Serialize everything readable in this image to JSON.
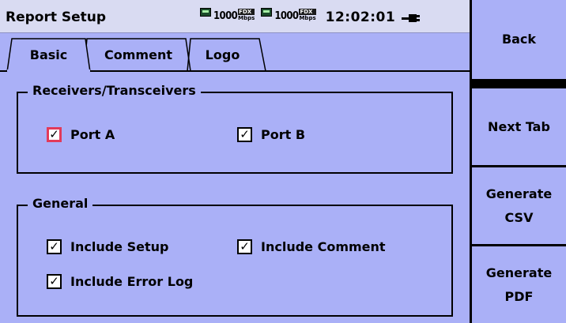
{
  "window": {
    "title": "Report Setup"
  },
  "status_bar": {
    "links": [
      {
        "speed": "1000",
        "duplex": "FDX",
        "unit": "Mbps"
      },
      {
        "speed": "1000",
        "duplex": "FDX",
        "unit": "Mbps"
      }
    ],
    "clock": "12:02:01",
    "link_color": "#13b13b"
  },
  "tabs": [
    {
      "label": "Basic",
      "active": true
    },
    {
      "label": "Comment",
      "active": false
    },
    {
      "label": "Logo",
      "active": false
    }
  ],
  "receivers": {
    "title": "Receivers/Transceivers",
    "port_a": {
      "label": "Port A",
      "checked": true,
      "focused": true
    },
    "port_b": {
      "label": "Port B",
      "checked": true
    }
  },
  "general": {
    "title": "General",
    "include_setup": {
      "label": "Include Setup",
      "checked": true
    },
    "include_comment": {
      "label": "Include Comment",
      "checked": true
    },
    "include_error_log": {
      "label": "Include Error Log",
      "checked": true
    }
  },
  "side_buttons": {
    "back": "Back",
    "next_tab": "Next Tab",
    "generate_csv_1": "Generate",
    "generate_csv_2": "CSV",
    "generate_pdf_1": "Generate",
    "generate_pdf_2": "PDF"
  },
  "check_glyph": "✓",
  "colors": {
    "background": "#aab0f7",
    "titlebar": "#d9dbf2",
    "focus": "#e23a5a"
  }
}
